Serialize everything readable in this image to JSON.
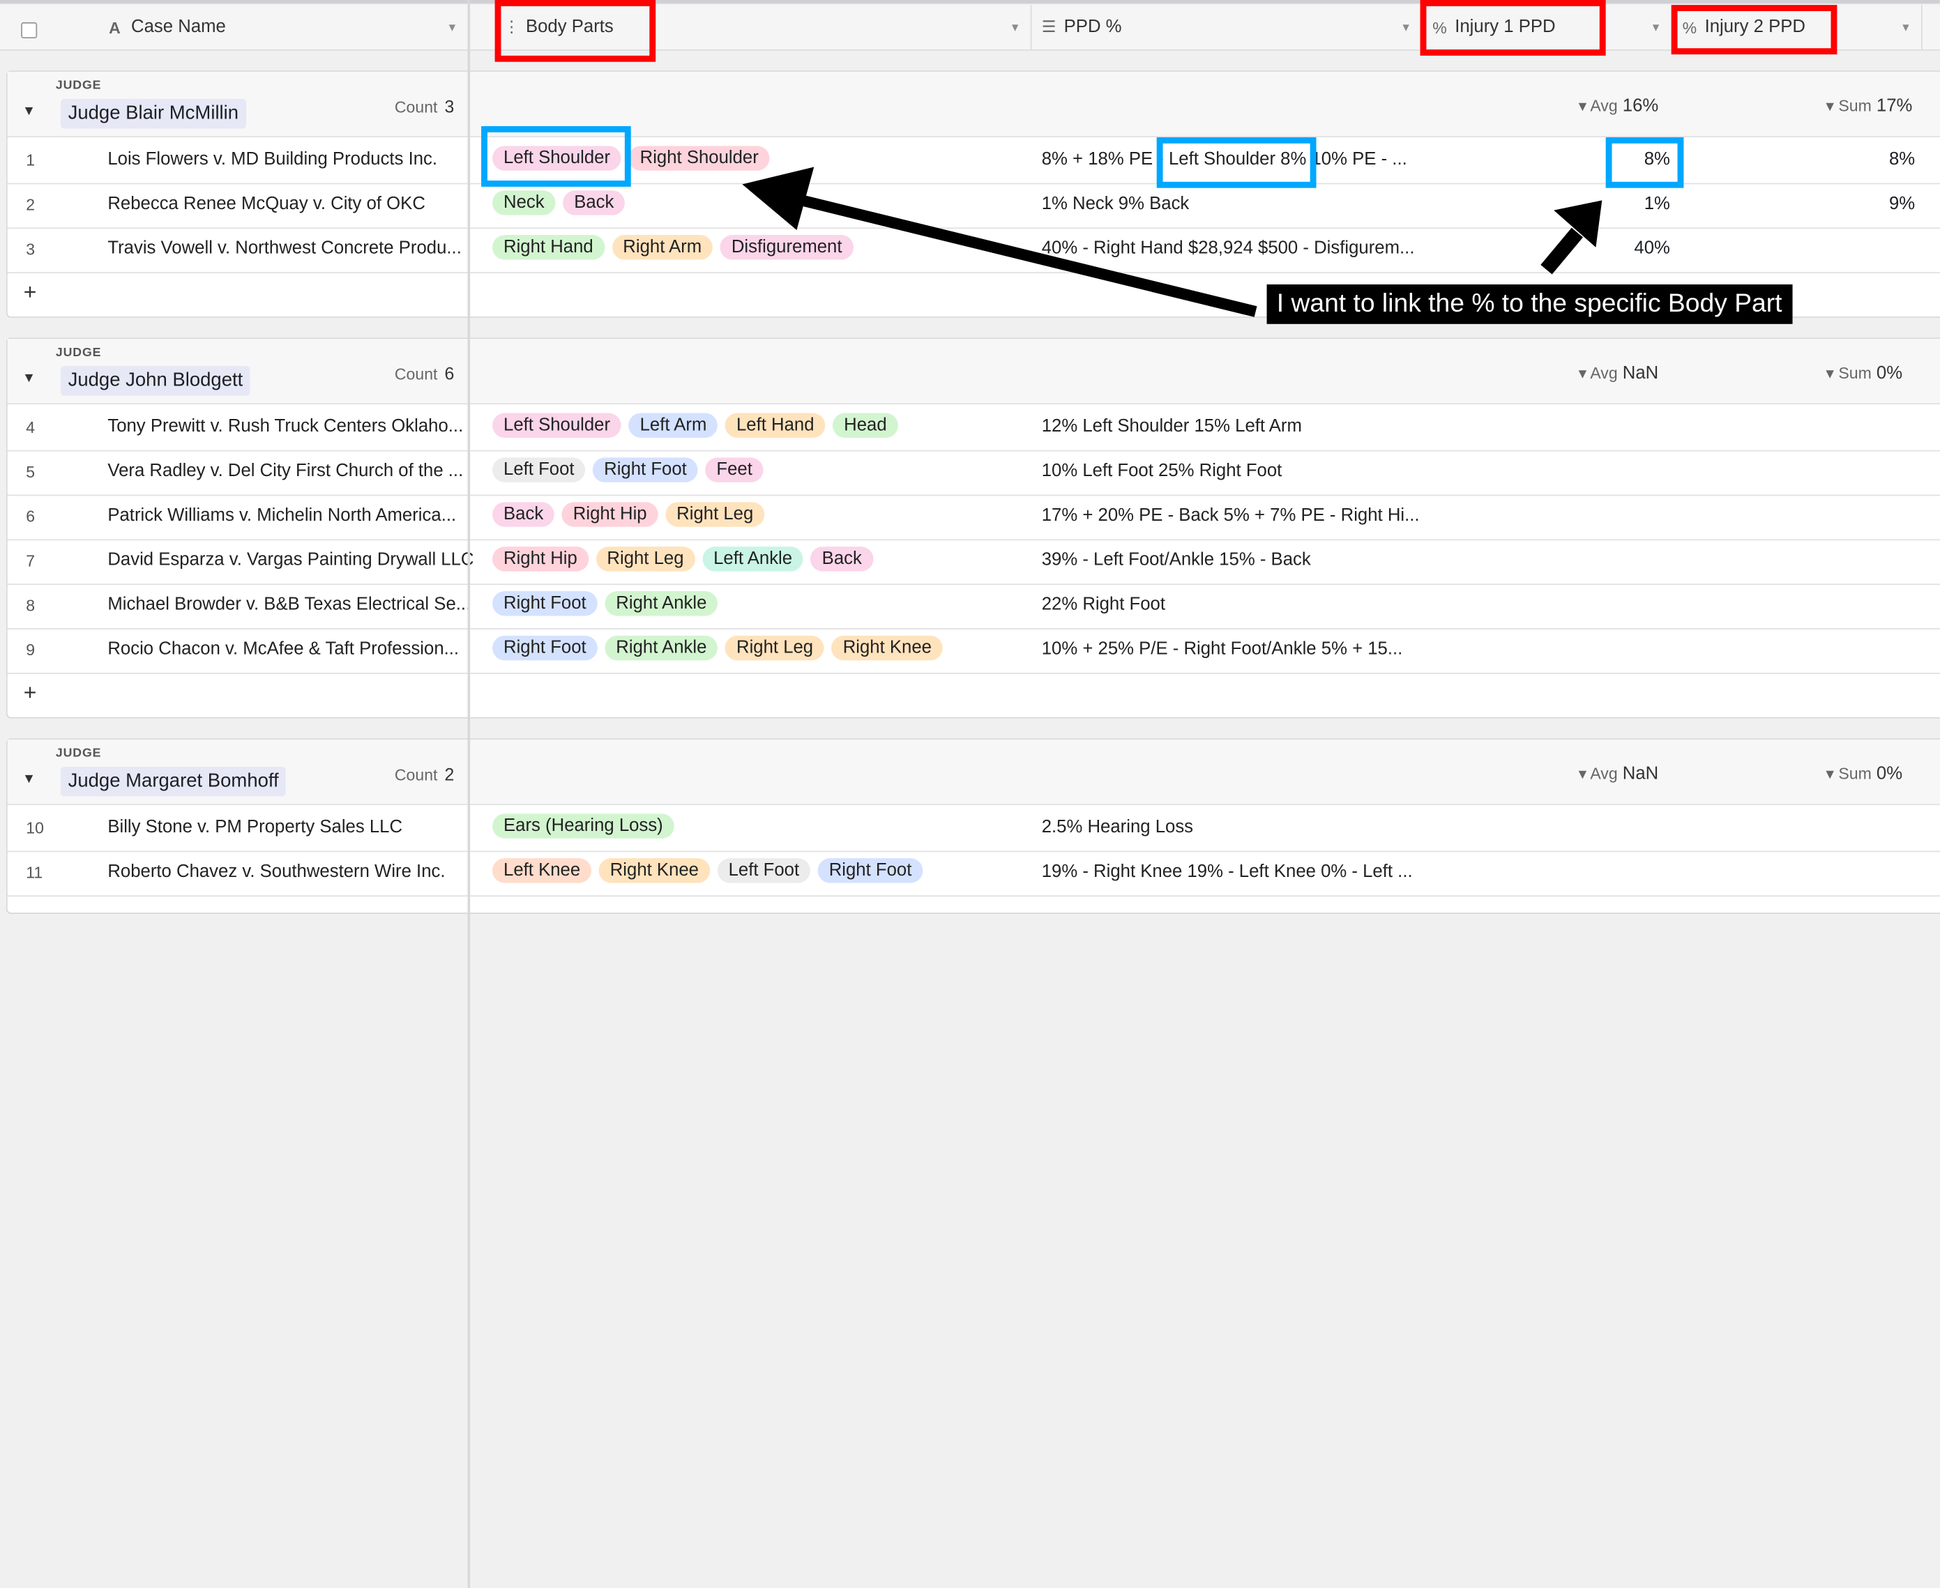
{
  "header": {
    "case_name": "Case Name",
    "body_parts": "Body Parts",
    "ppd_pct": "PPD %",
    "injury1": "Injury 1 PPD",
    "injury2": "Injury 2 PPD"
  },
  "icons": {
    "text_field": "text-icon",
    "drag": "drag-handle-icon",
    "long_text": "long-text-icon",
    "percent": "percent-icon",
    "caret": "chevron-down-icon"
  },
  "groups": [
    {
      "label": "JUDGE",
      "name": "Judge Blair McMillin",
      "count_label": "Count",
      "count": "3",
      "avg_label": "Avg",
      "avg": "16%",
      "sum_label": "Sum",
      "sum": "17%",
      "rows": [
        {
          "num": "1",
          "name": "Lois Flowers v. MD Building Products Inc.",
          "tags": [
            {
              "t": "Left Shoulder",
              "c": "pink"
            },
            {
              "t": "Right Shoulder",
              "c": "red-t"
            }
          ],
          "ppd": "8% + 18% PE - Left Shoulder 8% 10% PE - ...",
          "inj1": "8%",
          "inj2": "8%"
        },
        {
          "num": "2",
          "name": "Rebecca Renee McQuay v. City of OKC",
          "tags": [
            {
              "t": "Neck",
              "c": "green"
            },
            {
              "t": "Back",
              "c": "pink"
            }
          ],
          "ppd": "1% Neck 9% Back",
          "inj1": "1%",
          "inj2": "9%"
        },
        {
          "num": "3",
          "name": "Travis Vowell v. Northwest Concrete Produ...",
          "tags": [
            {
              "t": "Right Hand",
              "c": "green"
            },
            {
              "t": "Right Arm",
              "c": "orange"
            },
            {
              "t": "Disfigurement",
              "c": "pink"
            }
          ],
          "ppd": "40% - Right Hand $28,924 $500 - Disfigurem...",
          "inj1": "40%",
          "inj2": ""
        }
      ]
    },
    {
      "label": "JUDGE",
      "name": "Judge John Blodgett",
      "count_label": "Count",
      "count": "6",
      "avg_label": "Avg",
      "avg": "NaN",
      "sum_label": "Sum",
      "sum": "0%",
      "rows": [
        {
          "num": "4",
          "name": "Tony Prewitt v. Rush Truck Centers Oklaho...",
          "tags": [
            {
              "t": "Left Shoulder",
              "c": "pink"
            },
            {
              "t": "Left Arm",
              "c": "blue-t"
            },
            {
              "t": "Left Hand",
              "c": "orange"
            },
            {
              "t": "Head",
              "c": "green"
            }
          ],
          "ppd": "12% Left Shoulder 15% Left Arm",
          "inj1": "",
          "inj2": ""
        },
        {
          "num": "5",
          "name": "Vera Radley v. Del City First Church of the ...",
          "tags": [
            {
              "t": "Left Foot",
              "c": "gray"
            },
            {
              "t": "Right Foot",
              "c": "blue-t"
            },
            {
              "t": "Feet",
              "c": "pink"
            }
          ],
          "ppd": "10% Left Foot 25% Right Foot",
          "inj1": "",
          "inj2": ""
        },
        {
          "num": "6",
          "name": "Patrick Williams v. Michelin North America...",
          "tags": [
            {
              "t": "Back",
              "c": "pink"
            },
            {
              "t": "Right Hip",
              "c": "red-t"
            },
            {
              "t": "Right Leg",
              "c": "orange"
            }
          ],
          "ppd": "17% + 20% PE - Back 5% + 7% PE - Right Hi...",
          "inj1": "",
          "inj2": ""
        },
        {
          "num": "7",
          "name": "David Esparza v. Vargas Painting Drywall LLC",
          "tags": [
            {
              "t": "Right Hip",
              "c": "red-t"
            },
            {
              "t": "Right Leg",
              "c": "orange"
            },
            {
              "t": "Left Ankle",
              "c": "teal"
            },
            {
              "t": "Back",
              "c": "pink"
            }
          ],
          "ppd": "39% - Left Foot/Ankle 15% - Back",
          "inj1": "",
          "inj2": ""
        },
        {
          "num": "8",
          "name": "Michael Browder v. B&B Texas Electrical Se...",
          "tags": [
            {
              "t": "Right Foot",
              "c": "blue-t"
            },
            {
              "t": "Right Ankle",
              "c": "green"
            }
          ],
          "ppd": "22% Right Foot",
          "inj1": "",
          "inj2": ""
        },
        {
          "num": "9",
          "name": "Rocio Chacon v. McAfee & Taft Profession...",
          "tags": [
            {
              "t": "Right Foot",
              "c": "blue-t"
            },
            {
              "t": "Right Ankle",
              "c": "green"
            },
            {
              "t": "Right Leg",
              "c": "orange"
            },
            {
              "t": "Right Knee",
              "c": "orange"
            }
          ],
          "ppd": "10% + 25% P/E - Right Foot/Ankle 5% + 15...",
          "inj1": "",
          "inj2": ""
        }
      ]
    },
    {
      "label": "JUDGE",
      "name": "Judge Margaret Bomhoff",
      "count_label": "Count",
      "count": "2",
      "avg_label": "Avg",
      "avg": "NaN",
      "sum_label": "Sum",
      "sum": "0%",
      "rows": [
        {
          "num": "10",
          "name": "Billy Stone v. PM Property Sales LLC",
          "tags": [
            {
              "t": "Ears (Hearing Loss)",
              "c": "green"
            }
          ],
          "ppd": "2.5% Hearing Loss",
          "inj1": "",
          "inj2": ""
        },
        {
          "num": "11",
          "name": "Roberto Chavez v. Southwestern Wire Inc.",
          "tags": [
            {
              "t": "Left Knee",
              "c": "peach"
            },
            {
              "t": "Right Knee",
              "c": "orange"
            },
            {
              "t": "Left Foot",
              "c": "gray"
            },
            {
              "t": "Right Foot",
              "c": "blue-t"
            }
          ],
          "ppd": "19% - Right Knee 19% - Left Knee 0% - Left ...",
          "inj1": "",
          "inj2": ""
        }
      ]
    }
  ],
  "add_row": "+",
  "annotation": {
    "callout": "I want to link the % to the specific Body Part"
  }
}
